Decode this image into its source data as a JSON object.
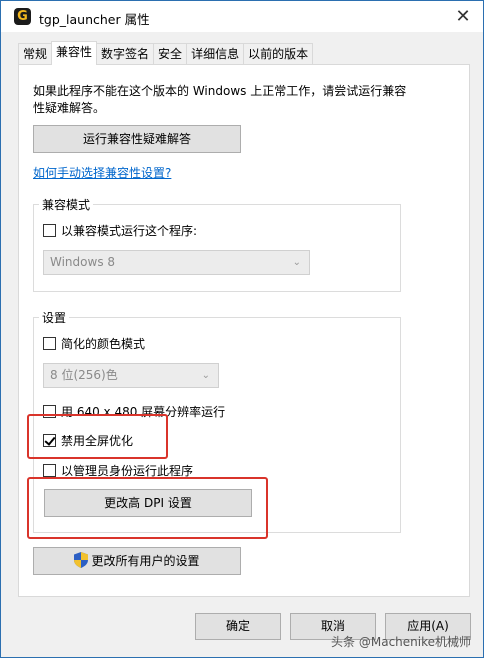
{
  "window": {
    "title": "tgp_launcher 属性",
    "app_icon_glyph": "G",
    "close_glyph": "✕"
  },
  "tabs": [
    {
      "label": "常规"
    },
    {
      "label": "兼容性"
    },
    {
      "label": "数字签名"
    },
    {
      "label": "安全"
    },
    {
      "label": "详细信息"
    },
    {
      "label": "以前的版本"
    }
  ],
  "active_tab": "兼容性",
  "intro": {
    "text": "如果此程序不能在这个版本的 Windows 上正常工作，请尝试运行兼容性疑难解答。"
  },
  "troubleshooter_button": "运行兼容性疑难解答",
  "manual_link": "如何手动选择兼容性设置?",
  "compat_mode": {
    "group_label": "兼容模式",
    "checkbox_label": "以兼容模式运行这个程序:",
    "checked": false,
    "os_select_value": "Windows 8"
  },
  "settings": {
    "group_label": "设置",
    "reduced_color": {
      "label": "简化的颜色模式",
      "checked": false
    },
    "color_select_value": "8 位(256)色",
    "low_res": {
      "label": "用 640 x 480 屏幕分辨率运行",
      "checked": false
    },
    "disable_fullscreen_opt": {
      "label": "禁用全屏优化",
      "checked": true
    },
    "run_as_admin": {
      "label": "以管理员身份运行此程序",
      "checked": false
    },
    "high_dpi_button": "更改高 DPI 设置"
  },
  "all_users_button": "更改所有用户的设置",
  "footer": {
    "ok": "确定",
    "cancel": "取消",
    "apply": "应用(A)"
  },
  "watermark": "头条 @Machenike机械师",
  "colors": {
    "highlight_red": "#d9342b",
    "link_blue": "#0066cc",
    "titlebar_border": "#2b6fb0"
  }
}
